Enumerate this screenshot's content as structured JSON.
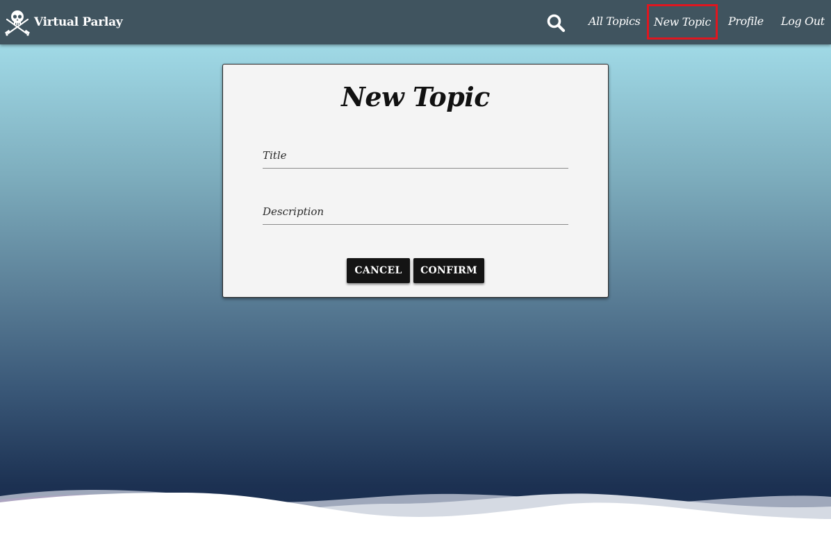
{
  "navbar": {
    "brand": "Virtual Parlay",
    "logo_icon": "jolly-roger-icon",
    "search_icon": "search-icon",
    "items": [
      {
        "label": "All Topics"
      },
      {
        "label": "New Topic"
      },
      {
        "label": "Profile"
      },
      {
        "label": "Log Out"
      }
    ],
    "active_item": "New Topic",
    "colors": {
      "bar": "#40545f",
      "highlight": "#e0161f"
    }
  },
  "form": {
    "title": "New Topic",
    "title_placeholder": "Title",
    "description_placeholder": "Description",
    "cancel_label": "CANCEL",
    "confirm_label": "CONFIRM"
  }
}
